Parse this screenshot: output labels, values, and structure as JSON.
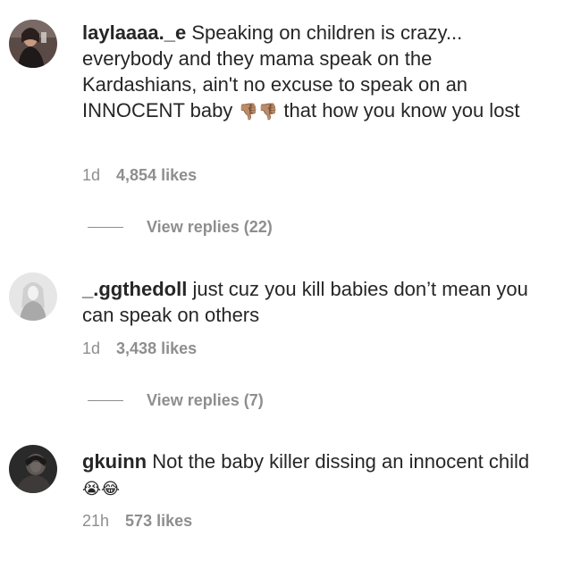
{
  "comments": [
    {
      "username": "laylaaaa._e",
      "text": "Speaking on children is crazy... everybody and they mama speak on the Kardashians, ain't no excuse to speak on an INNOCENT baby",
      "emoji": "👎🏽👎🏽",
      "text_after": "that how you know you lost",
      "time": "1d",
      "likes": "4,854 likes",
      "replies": "View replies (22)"
    },
    {
      "username": "_.ggthedoll",
      "text": "just cuz you kill babies don’t mean you can speak on others",
      "time": "1d",
      "likes": "3,438 likes",
      "replies": "View replies (7)"
    },
    {
      "username": "gkuinn",
      "text": "Not the baby killer dissing an innocent child",
      "emoji": "😭😂",
      "time": "21h",
      "likes": "573 likes"
    }
  ]
}
